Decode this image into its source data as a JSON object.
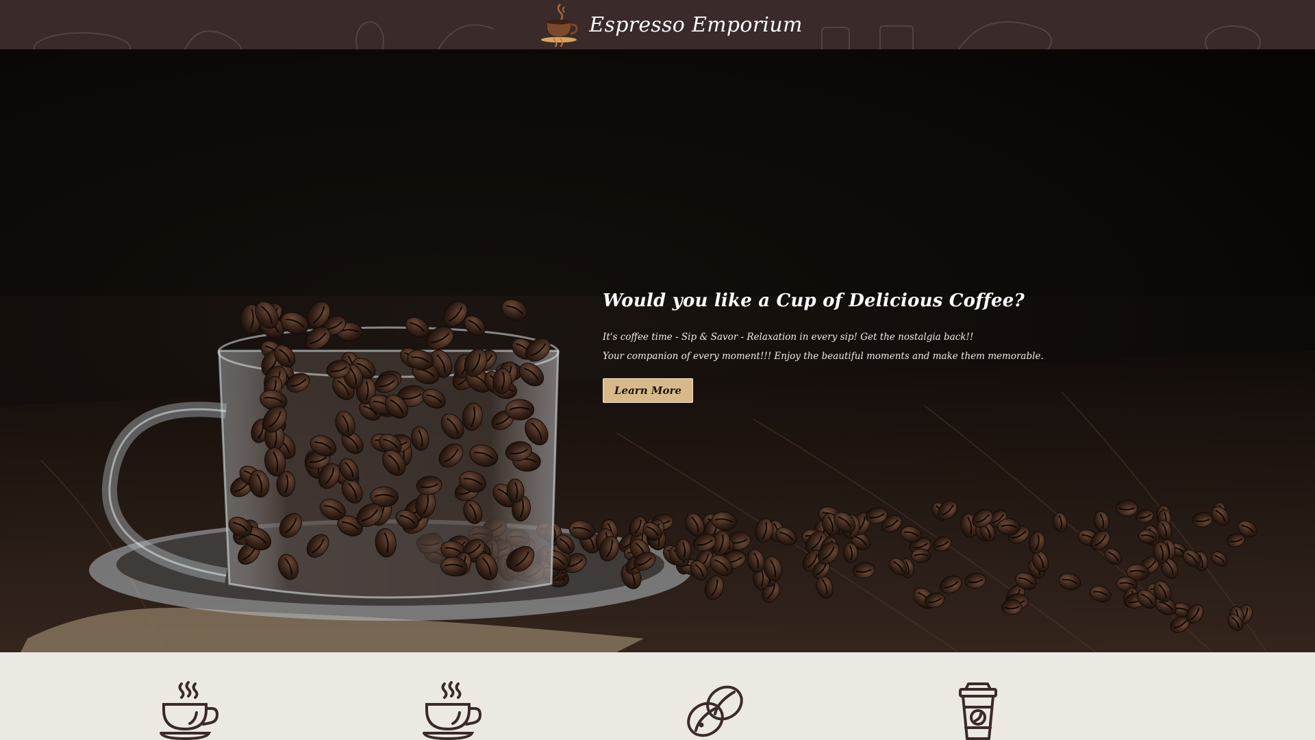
{
  "header": {
    "brand_name": "Espresso Emporium",
    "logo_icon": "coffee-cup-logo-icon"
  },
  "hero": {
    "title": "Would you like a Cup of Delicious Coffee?",
    "line1": "It's coffee time - Sip & Savor - Relaxation in every sip! Get the nostalgia back!!",
    "line2": "Your companion of every moment!!! Enjoy the beautiful moments and make them memorable.",
    "cta_label": "Learn More",
    "background_image": "glass-cup-of-coffee-beans-photo"
  },
  "features": {
    "icons": [
      "hot-coffee-cup-icon",
      "hot-coffee-mug-icon",
      "coffee-bean-icon",
      "takeaway-coffee-cup-icon"
    ]
  },
  "colors": {
    "header_bg": "#3a2a2a",
    "cta_bg": "#d8b98b",
    "features_bg": "#ece9e3",
    "icon_stroke": "#3a2a2a"
  }
}
